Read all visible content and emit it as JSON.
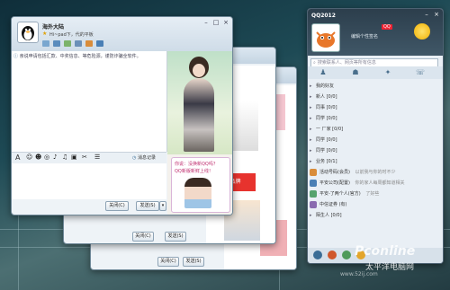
{
  "chat_window": {
    "title": "海外大陆",
    "status_line": "Hi~pad下，代的平板",
    "notice": "亲说申请包括汇款、中奖信息、等危险源，谨防诈骗全软件。",
    "font_btn": "A",
    "history_label": "消息记录",
    "close_label": "关闭(C)",
    "send_label": "发送(S)",
    "promo_line1": "你说：没换新QQ吗？",
    "promo_line2": "QQ新版新鲜上线！"
  },
  "back_windows": {
    "w2": {
      "close_label": "关闭(C)",
      "send_label": "发送(S)"
    },
    "w3": {
      "close_label": "关闭(C)",
      "send_label": "发送(S)"
    },
    "ad_text": "当头",
    "ad_text2": "品牌"
  },
  "qq_panel": {
    "title": "QQ2012",
    "signature": "编辑个性签名",
    "level_badge": "QQ",
    "search_placeholder": "搜索联系人、网页等所有信息",
    "groups": [
      "我的好友",
      "新人 [0/0]",
      "同事 [0/0]",
      "同学 [0/0]",
      "一 厂家 [0/0]",
      "同学 [0/0]",
      "同学 [0/0]",
      "业务 [0/1]"
    ],
    "contacts": [
      {
        "name": "活动号码(会员)",
        "note": "以前我与你的时不少",
        "color": "#d98c3a"
      },
      {
        "name": "平安公司(配置)",
        "note": "你的家人每周都知道相关",
        "color": "#4a7fb5"
      },
      {
        "name": "平安-了两个人(官方)",
        "note": "了好些",
        "color": "#55a36d"
      },
      {
        "name": "中信证券 (有)",
        "note": "",
        "color": "#8a6bb0"
      },
      {
        "name": "陌生人 [0/0]",
        "note": "",
        "color": "#9aa"
      }
    ],
    "watermark_main": "Pconline",
    "watermark_sub": "太平洋电脑网",
    "watermark_url": "www.52ij.com"
  },
  "colors": {
    "accent": "#3b6d96",
    "qq_top": "#2c3e4c"
  }
}
